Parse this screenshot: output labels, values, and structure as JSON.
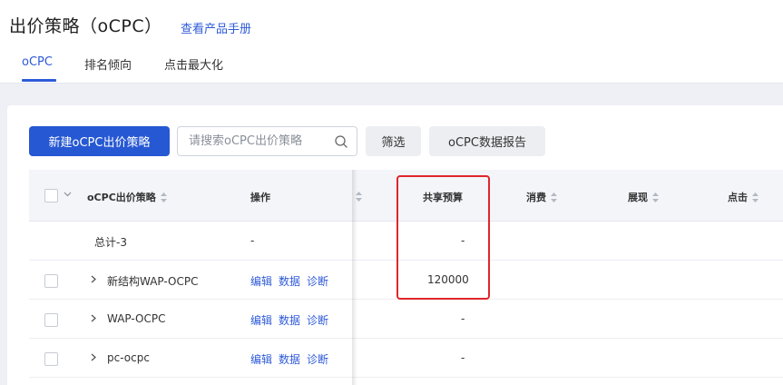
{
  "header": {
    "title": "出价策略（oCPC）",
    "manual_link": "查看产品手册",
    "tabs": [
      {
        "label": "oCPC",
        "active": true
      },
      {
        "label": "排名倾向",
        "active": false
      },
      {
        "label": "点击最大化",
        "active": false
      }
    ]
  },
  "toolbar": {
    "new_button": "新建oCPC出价策略",
    "search_placeholder": "请搜索oCPC出价策略",
    "filter_button": "筛选",
    "report_button": "oCPC数据报告"
  },
  "table": {
    "columns": [
      "oCPC出价策略",
      "操作",
      "共享预算",
      "消费",
      "展现",
      "点击"
    ],
    "total_row": {
      "name": "总计-3",
      "action": "-",
      "budget": "-"
    },
    "rows": [
      {
        "name": "新结构WAP-OCPC",
        "actions": [
          "编辑",
          "数据",
          "诊断"
        ],
        "budget": "120000"
      },
      {
        "name": "WAP-OCPC",
        "actions": [
          "编辑",
          "数据",
          "诊断"
        ],
        "budget": "-"
      },
      {
        "name": "pc-ocpc",
        "actions": [
          "编辑",
          "数据",
          "诊断"
        ],
        "budget": "-"
      }
    ]
  },
  "colors": {
    "primary": "#2658d3",
    "link": "#2e5bd8",
    "highlight": "#e0262b"
  }
}
